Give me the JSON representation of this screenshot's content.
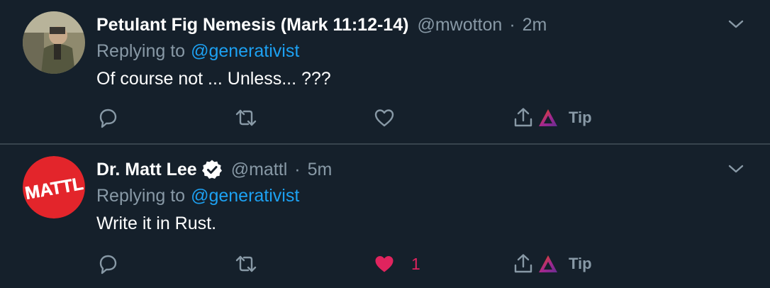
{
  "tweets": [
    {
      "display_name": "Petulant Fig Nemesis (Mark 11:12-14)",
      "handle": "@mwotton",
      "separator": "·",
      "time": "2m",
      "verified": false,
      "replying_prefix": "Replying to",
      "replying_to": "@generativist",
      "text": "Of course not ... Unless... ???",
      "liked": false,
      "like_count": "",
      "tip_label": "Tip"
    },
    {
      "display_name": "Dr. Matt Lee",
      "handle": "@mattl",
      "separator": "·",
      "time": "5m",
      "verified": true,
      "replying_prefix": "Replying to",
      "replying_to": "@generativist",
      "text": "Write it in Rust.",
      "liked": true,
      "like_count": "1",
      "tip_label": "Tip",
      "avatar_text": "MATTL"
    }
  ],
  "colors": {
    "background": "#15202b",
    "divider": "#38444d",
    "muted": "#8899a6",
    "link": "#1da1f2",
    "like": "#e0245e"
  }
}
